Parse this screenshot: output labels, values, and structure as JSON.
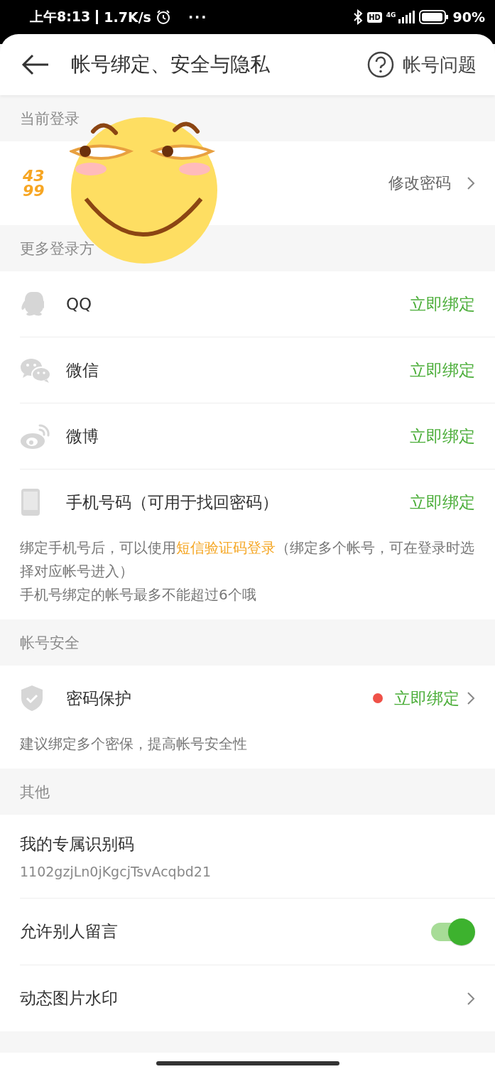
{
  "status_bar": {
    "time": "上午8:13",
    "speed": "1.7K/s",
    "more": "···",
    "hd": "HD",
    "network": "4G",
    "battery": "90%"
  },
  "header": {
    "title": "帐号绑定、安全与隐私",
    "help": "帐号问题"
  },
  "sections": [
    {
      "title": "当前登录",
      "rows": [
        {
          "kind": "account",
          "logo_lines": [
            "43",
            "99"
          ],
          "action": "修改密码"
        }
      ]
    },
    {
      "title": "更多登录方",
      "rows": [
        {
          "kind": "qq",
          "label": "QQ",
          "action": "立即绑定",
          "alert": false,
          "chevron": false
        },
        {
          "kind": "wechat",
          "label": "微信",
          "action": "立即绑定",
          "alert": false,
          "chevron": false
        },
        {
          "kind": "weibo",
          "label": "微博",
          "action": "立即绑定",
          "alert": false,
          "chevron": false
        },
        {
          "kind": "phone",
          "label": "手机号码（可用于找回密码）",
          "action": "立即绑定",
          "alert": false,
          "chevron": false
        }
      ],
      "notes": [
        [
          {
            "text": "绑定手机号后，可以使用"
          },
          {
            "text": "短信验证码登录",
            "kind": "link"
          },
          {
            "text": "（绑定多个帐号，可在登录时选择对应帐号进入）"
          }
        ],
        [
          {
            "text": "手机号绑定的帐号最多不能超过6个哦"
          }
        ]
      ]
    },
    {
      "title": "帐号安全",
      "rows": [
        {
          "kind": "shield",
          "label": "密码保护",
          "action": "立即绑定",
          "alert": true,
          "chevron": true
        }
      ],
      "notes": [
        [
          {
            "text": "建议绑定多个密保，提高帐号安全性"
          }
        ]
      ]
    },
    {
      "title": "其他",
      "rows": [
        {
          "kind": "code",
          "label": "我的专属识别码",
          "value": "1102gzjLn0jKgcjTsvAcqbd21"
        },
        {
          "kind": "toggle",
          "label": "允许别人留言",
          "on": true
        },
        {
          "kind": "link",
          "label": "动态图片水印"
        }
      ]
    }
  ]
}
